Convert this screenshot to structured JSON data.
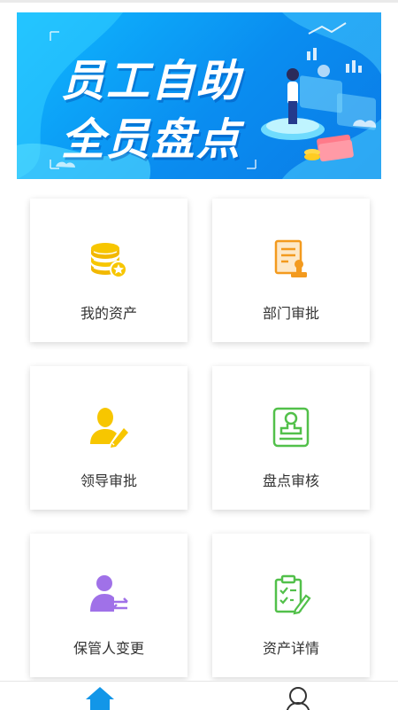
{
  "banner": {
    "title_line1": "员工自助",
    "title_line2": "全员盘点"
  },
  "menu": {
    "items": [
      {
        "label": "我的资产",
        "icon": "coins-icon",
        "color": "#f7c600"
      },
      {
        "label": "部门审批",
        "icon": "document-stamp-icon",
        "color": "#f39a1e"
      },
      {
        "label": "领导审批",
        "icon": "person-edit-icon",
        "color": "#f7c600"
      },
      {
        "label": "盘点审核",
        "icon": "stamp-icon",
        "color": "#52c04a"
      },
      {
        "label": "保管人变更",
        "icon": "person-transfer-icon",
        "color": "#a071e8"
      },
      {
        "label": "资产详情",
        "icon": "clipboard-check-icon",
        "color": "#52c04a"
      }
    ]
  },
  "tabbar": {
    "items": [
      {
        "name": "home",
        "icon": "home-icon",
        "active": true,
        "color": "#1296e8"
      },
      {
        "name": "me",
        "icon": "user-icon",
        "active": false,
        "color": "#333333"
      }
    ]
  }
}
